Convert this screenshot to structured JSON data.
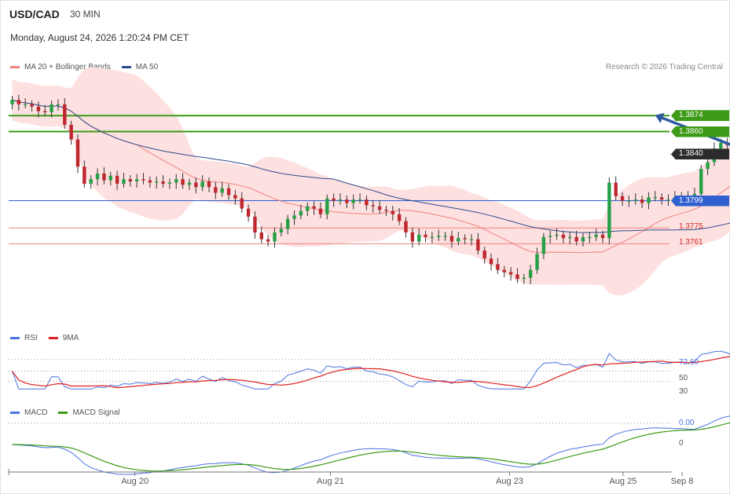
{
  "header": {
    "symbol": "USD/CAD",
    "timeframe": "30 MIN",
    "datetime": "Monday, August 24, 2026 1:20:24 PM CET"
  },
  "credit": "Research © 2026 Trading Central",
  "colors": {
    "up": "#26a046",
    "down": "#c0262d",
    "bb_fill": "#fde0e0",
    "ma20": "#f08080",
    "ma50": "#2e4c8c",
    "resistance": "#3c9a16",
    "pivot": "#3060d0",
    "support": "#f08080",
    "rsi": "#4a72e0",
    "rsi_ma": "#e02020",
    "macd": "#4a72e0",
    "macd_signal": "#3c9a16",
    "arrow": "#2f5c9e",
    "current": "#2b2b2b"
  },
  "chart_data": [
    {
      "type": "candlestick",
      "panel": "price",
      "legend": [
        "MA 20 + Bollinger Bands",
        "MA 50"
      ],
      "ylim": [
        1.3692,
        1.3904
      ],
      "x_axis_labels": [
        "Aug 20",
        "Aug 21",
        "Aug 23",
        "Aug 25",
        "Sep 8"
      ],
      "x_axis_label_index": [
        18.7,
        48.5,
        75.8,
        93.1,
        102.1
      ],
      "series_close": [
        1.3888,
        1.3884,
        1.3884,
        1.3882,
        1.3878,
        1.3877,
        1.3884,
        1.3884,
        1.3866,
        1.3853,
        1.3829,
        1.3814,
        1.3818,
        1.3823,
        1.3817,
        1.3821,
        1.3814,
        1.3818,
        1.3816,
        1.3818,
        1.3817,
        1.3815,
        1.3816,
        1.3814,
        1.3815,
        1.3818,
        1.3813,
        1.3815,
        1.3811,
        1.3816,
        1.3811,
        1.3806,
        1.381,
        1.3804,
        1.3801,
        1.3792,
        1.3785,
        1.3771,
        1.3765,
        1.3763,
        1.3771,
        1.3774,
        1.3783,
        1.3786,
        1.379,
        1.3794,
        1.3792,
        1.3787,
        1.3801,
        1.3799,
        1.38,
        1.3797,
        1.38,
        1.38,
        1.3795,
        1.3794,
        1.3791,
        1.379,
        1.3787,
        1.3781,
        1.3771,
        1.3763,
        1.3769,
        1.3767,
        1.3767,
        1.3768,
        1.3768,
        1.3763,
        1.3766,
        1.3765,
        1.3765,
        1.3755,
        1.3748,
        1.3743,
        1.3738,
        1.3736,
        1.3734,
        1.373,
        1.3731,
        1.3738,
        1.3752,
        1.3767,
        1.3768,
        1.3769,
        1.3766,
        1.3767,
        1.3763,
        1.3767,
        1.3767,
        1.3769,
        1.3766,
        1.3815,
        1.3803,
        1.3799,
        1.3799,
        1.38,
        1.3797,
        1.3802,
        1.3802,
        1.38,
        1.38,
        1.3802,
        1.3803,
        1.3802,
        1.3805,
        1.3827,
        1.3833,
        1.3845,
        1.385,
        1.3848,
        1.3844,
        1.3839,
        1.384
      ],
      "levels": [
        {
          "label": "1.3874",
          "value": 1.3874,
          "kind": "resistance"
        },
        {
          "label": "1.3860",
          "value": 1.386,
          "kind": "resistance"
        },
        {
          "label": "1.3840",
          "value": 1.384,
          "kind": "current"
        },
        {
          "label": "1.3799",
          "value": 1.3799,
          "kind": "pivot"
        },
        {
          "label": "1.3775",
          "value": 1.3775,
          "kind": "support"
        },
        {
          "label": "1.3761",
          "value": 1.3761,
          "kind": "support"
        }
      ],
      "target_arrow": {
        "from": 1.384,
        "to": 1.3874
      }
    },
    {
      "type": "line",
      "panel": "rsi",
      "legend": [
        "RSI",
        "9MA"
      ],
      "ylim": [
        0,
        100
      ],
      "tick_labels": [
        "72.60",
        "50",
        "30"
      ],
      "last_value": 72.6
    },
    {
      "type": "line",
      "panel": "macd",
      "legend": [
        "MACD",
        "MACD Signal"
      ],
      "tick_labels": [
        "0.00",
        "0"
      ],
      "last_value": 0.0
    }
  ]
}
